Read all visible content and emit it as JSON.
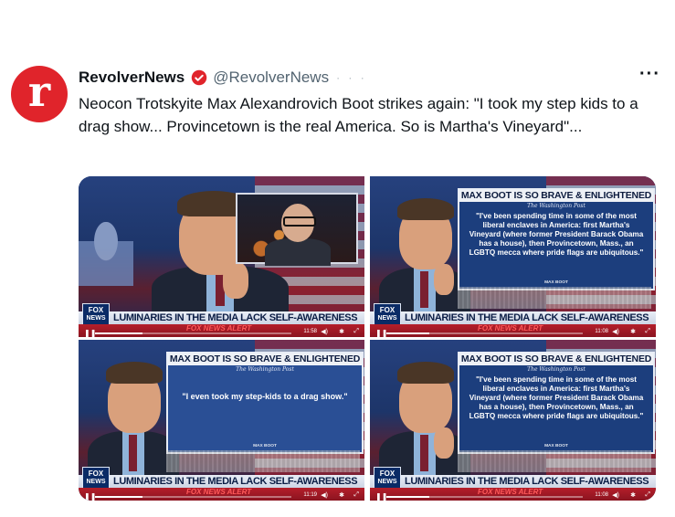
{
  "author": {
    "avatar_letter": "r",
    "name": "RevolverNews",
    "handle": "@RevolverNews",
    "timestamp_blur": "· · ·",
    "more": "···"
  },
  "tweet": {
    "text": "Neocon Trotskyite Max Alexandrovich Boot strikes again: \"I took my step kids to a drag show... Provincetown is the real America. So is Martha's Vineyard\"..."
  },
  "panels": [
    {
      "type": "guest",
      "fox_logo_top": "FOX",
      "fox_logo_bottom": "NEWS",
      "lower_third": "LUMINARIES IN THE MEDIA LACK SELF-AWARENESS",
      "alert": "FOX NEWS ALERT",
      "time": "11:58",
      "progress": 0.24
    },
    {
      "type": "card",
      "card_title": "MAX BOOT IS SO BRAVE & ENLIGHTENED",
      "card_source": "The Washington Post",
      "card_quote": "\"I've been spending time in some of the most liberal enclaves in America: first Martha's Vineyard (where former President Barack Obama has a house), then Provincetown, Mass., an LGBTQ mecca where pride flags are ubiquitous.\"",
      "card_byline": "MAX BOOT",
      "fox_logo_top": "FOX",
      "fox_logo_bottom": "NEWS",
      "lower_third": "LUMINARIES IN THE MEDIA LACK SELF-AWARENESS",
      "alert": "FOX NEWS ALERT",
      "time": "11:08",
      "progress": 0.22
    },
    {
      "type": "card",
      "card_title": "MAX BOOT IS SO BRAVE & ENLIGHTENED",
      "card_source": "The Washington Post",
      "card_quote": "\"I even took my step-kids to a drag show.\"",
      "card_byline": "MAX BOOT",
      "fox_logo_top": "FOX",
      "fox_logo_bottom": "NEWS",
      "lower_third": "LUMINARIES IN THE MEDIA LACK SELF-AWARENESS",
      "alert": "FOX NEWS ALERT",
      "time": "11:19",
      "progress": 0.24
    },
    {
      "type": "card",
      "card_title": "MAX BOOT IS SO BRAVE & ENLIGHTENED",
      "card_source": "The Washington Post",
      "card_quote": "\"I've been spending time in some of the most liberal enclaves in America: first Martha's Vineyard (where former President Barack Obama has a house), then Provincetown, Mass., an LGBTQ mecca where pride flags are ubiquitous.\"",
      "card_byline": "MAX BOOT",
      "fox_logo_top": "FOX",
      "fox_logo_bottom": "NEWS",
      "lower_third": "LUMINARIES IN THE MEDIA LACK SELF-AWARENESS",
      "alert": "FOX NEWS ALERT",
      "time": "11:08",
      "progress": 0.22
    }
  ],
  "player": {
    "pause_icon": "pause-icon",
    "volume_icon": "volume-icon",
    "settings_icon": "gear-icon",
    "fullscreen_icon": "fullscreen-icon",
    "pause_glyph": "❚❚",
    "volume_glyph": "◀)",
    "gear_glyph": "✱",
    "fullscreen_glyph": "⤢"
  },
  "colors": {
    "avatar": "#e0242b",
    "verified": "#e0242b"
  }
}
